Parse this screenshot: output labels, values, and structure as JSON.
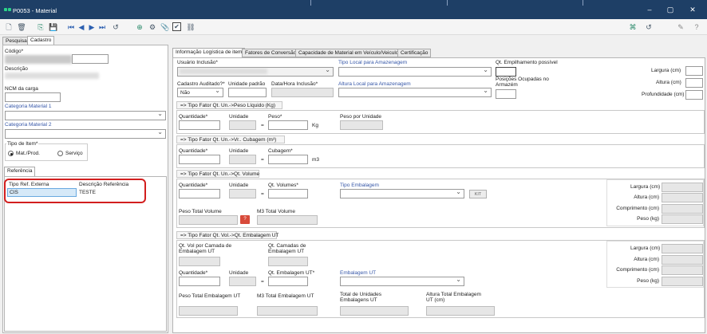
{
  "window": {
    "title": "P0053 - Material",
    "minimize": "–",
    "maximize": "▢",
    "close": "✕"
  },
  "toolbar": {
    "icons": [
      "new-doc-icon",
      "delete-icon",
      "copy-icon",
      "save-icon",
      "first-record-icon",
      "prev-record-icon",
      "next-record-icon",
      "last-record-icon",
      "execute-icon",
      "add-icon",
      "settings-icon",
      "attach-icon",
      "check-icon",
      "link-icon"
    ],
    "right_icons": [
      "filter-icon",
      "execute-icon",
      "edit-icon",
      "help-icon"
    ]
  },
  "main_tabs": [
    "Pesquisa",
    "Cadastro"
  ],
  "left": {
    "codigo_label": "Código*",
    "descricao_label": "Descrição",
    "ncm_label": "NCM da carga",
    "cat1_label": "Categoria Material 1",
    "cat2_label": "Categoria Material 2",
    "tipo_item_label": "Tipo de Item*",
    "radio_mat": "Mat./Prod.",
    "radio_serv": "Serviço",
    "ref_tab": "Referência",
    "ref_table": {
      "headers": [
        "Tipo Ref. Externa",
        "Descrição Referência"
      ],
      "rows": [
        [
          "CIS",
          "TESTE"
        ]
      ]
    }
  },
  "right_tabs": [
    "Informação Logística de item",
    "Fatores de Conversão",
    "Capacidade de Material em Veículo/Veiculo",
    "Certificação"
  ],
  "logistic": {
    "usuario_inclusao": "Usuário Inclusão*",
    "tipo_local": "Tipo Local para Amazenagem",
    "qt_empilhamento": "Qt. Empilhamento possível",
    "largura": "Largura (cm)",
    "altura": "Altura (cm)",
    "profundidade": "Profundidade (cm)",
    "cadastro_auditado": "Cadastro Auditado?*",
    "cadastro_auditado_value": "Não",
    "unidade_padrao": "Unidade padrão",
    "data_hora": "Data/Hora Inclusão*",
    "altura_local": "Altura Local para Amazenagem",
    "posicoes": "Posições Ocupadas no Armazém"
  },
  "sec_peso": {
    "title": "=> Tipo Fator Qt. Un.->Peso Líquido (Kg)",
    "quantidade": "Quantidade*",
    "unidade": "Unidade",
    "peso": "Peso*",
    "unit": "Kg",
    "peso_unidade": "Peso por Unidade",
    "eq": "="
  },
  "sec_cubagem": {
    "title": "=> Tipo Fator Qt. Un.->Vr.. Cubagem (m³)",
    "quantidade": "Quantidade*",
    "unidade": "Unidade",
    "cubagem": "Cubagem*",
    "unit": "m3",
    "eq": "="
  },
  "sec_volume": {
    "title": "=> Tipo Fator Qt. Un.->Qt. Volume",
    "quantidade": "Quantidade*",
    "unidade": "Unidade",
    "qt_volumes": "Qt. Volumes*",
    "tipo_embalagem": "Tipo Embalagem",
    "kit": "KIT",
    "peso_total": "Peso Total Volume",
    "m3_total": "M3 Total Volume",
    "eq": "=",
    "question": "?",
    "dims": [
      "Largura (cm)",
      "Altura (cm)",
      "Comprimento (cm)",
      "Peso (kg)"
    ]
  },
  "sec_embalagem": {
    "title": "=> Tipo Fator Qt. Vol.->Qt. Embalagem UT",
    "qt_vol_camada": "Qt. Vol por Camada de Embalagem UT",
    "qt_camadas": "Qt. Camadas de Embalagem UT",
    "quantidade": "Quantidade*",
    "unidade": "Unidade",
    "qt_embalagem": "Qt. Embalagem UT*",
    "embalagem_ut": "Embalagem UT",
    "peso_total": "Peso Total Embalagem UT",
    "m3_total": "M3 Total Embalagem UT",
    "total_unidades": "Total de Unidades Embalagens UT",
    "altura_total": "Altura Total Embalagem UT (cm)",
    "eq": "=",
    "dims": [
      "Largura (cm)",
      "Altura (cm)",
      "Comprimento (cm)",
      "Peso (kg)"
    ]
  }
}
